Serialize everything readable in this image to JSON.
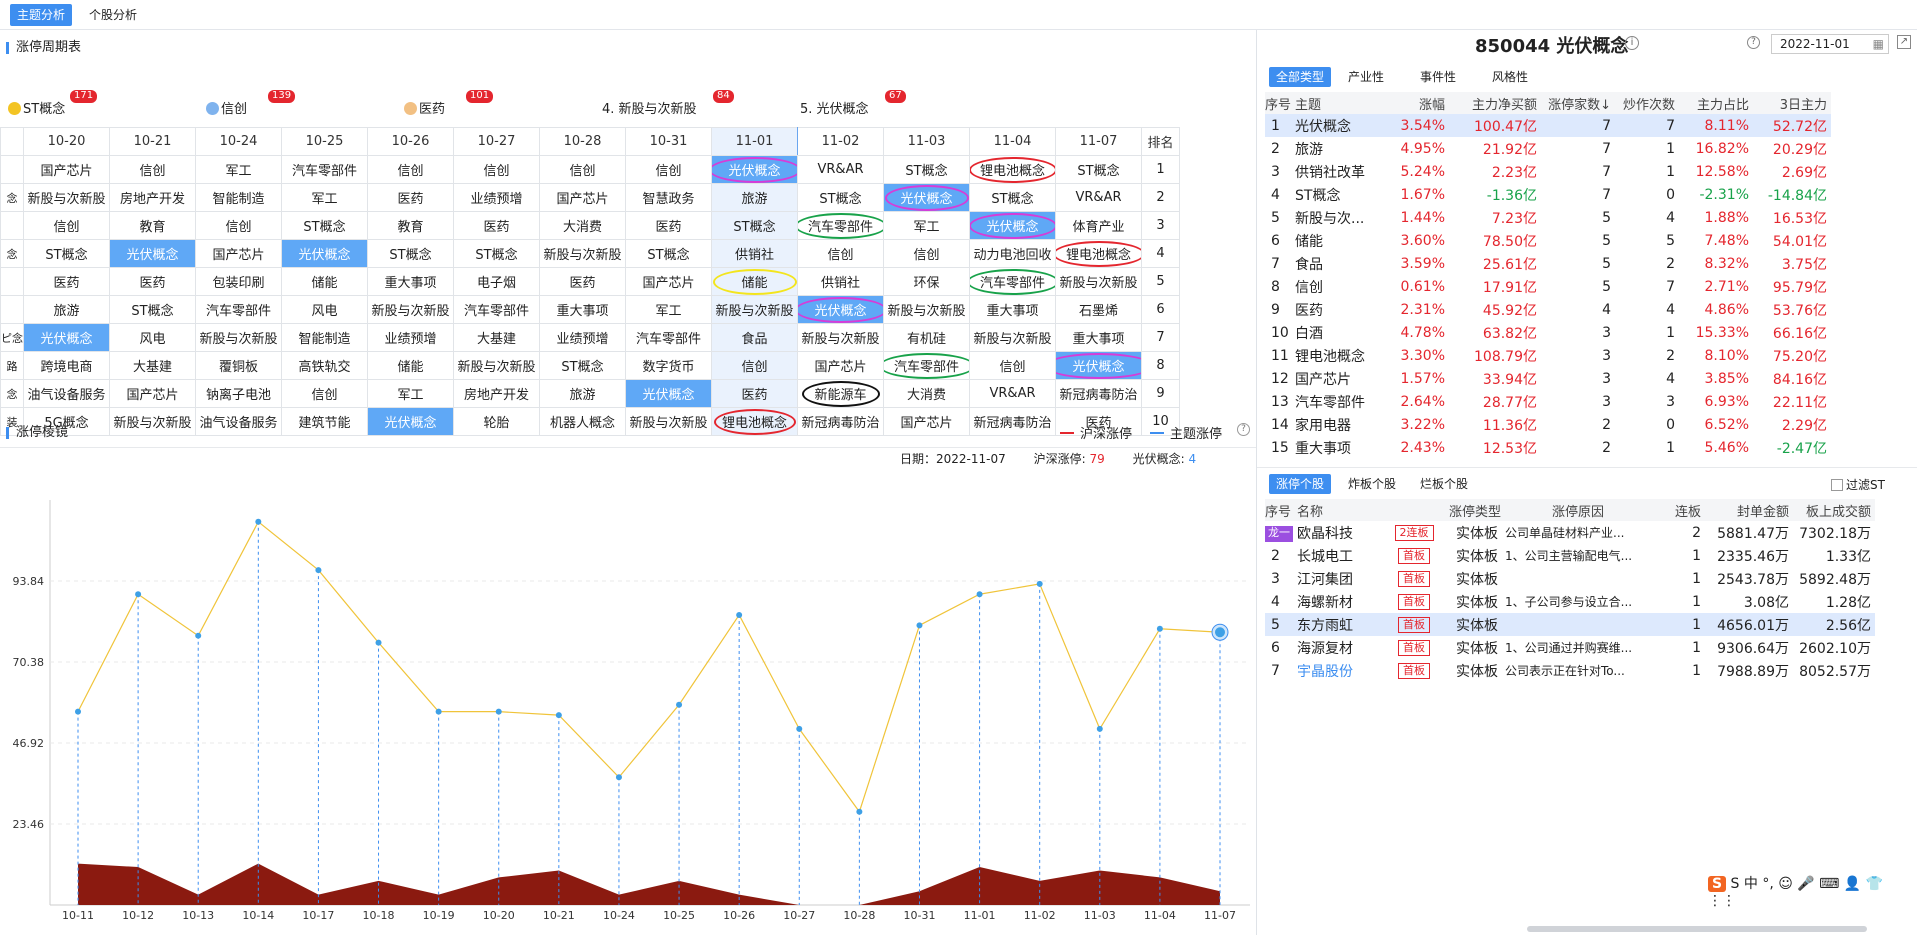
{
  "tabs": [
    "主题分析",
    "个股分析"
  ],
  "left": {
    "section1_title": "涨停周期表",
    "hot": [
      {
        "name": "ST概念",
        "count": "171",
        "dot": "#f3c424"
      },
      {
        "name": "信创",
        "count": "139",
        "dot": "#7fb3ee"
      },
      {
        "name": "医药",
        "count": "101",
        "dot": "#f2c083"
      },
      {
        "name": "4. 新股与次新股",
        "count": "84",
        "dot": ""
      },
      {
        "name": "5. 光伏概念",
        "count": "67",
        "dot": ""
      }
    ],
    "dates": [
      "10-20",
      "10-21",
      "10-24",
      "10-25",
      "10-26",
      "10-27",
      "10-28",
      "10-31",
      "11-01",
      "11-02",
      "11-03",
      "11-04",
      "11-07"
    ],
    "rank_label": "排名",
    "stub": [
      "",
      "念",
      "",
      "念",
      "",
      "",
      "ピ念",
      "路",
      "念",
      "装"
    ],
    "rows": [
      [
        "国产芯片",
        "信创",
        "军工",
        "汽车零部件",
        "信创",
        "信创",
        "信创",
        "信创",
        "光伏概念",
        "VR&AR",
        "ST概念",
        "锂电池概念",
        "ST概念"
      ],
      [
        "新股与次新股",
        "房地产开发",
        "智能制造",
        "军工",
        "医药",
        "业绩预增",
        "国产芯片",
        "智慧政务",
        "旅游",
        "ST概念",
        "光伏概念",
        "ST概念",
        "VR&AR"
      ],
      [
        "信创",
        "教育",
        "信创",
        "ST概念",
        "教育",
        "医药",
        "大消费",
        "医药",
        "ST概念",
        "汽车零部件",
        "军工",
        "光伏概念",
        "体育产业"
      ],
      [
        "ST概念",
        "光伏概念",
        "国产芯片",
        "光伏概念",
        "ST概念",
        "ST概念",
        "新股与次新股",
        "ST概念",
        "供销社",
        "信创",
        "信创",
        "动力电池回收",
        "锂电池概念"
      ],
      [
        "医药",
        "医药",
        "包装印刷",
        "储能",
        "重大事项",
        "电子烟",
        "医药",
        "国产芯片",
        "储能",
        "供销社",
        "环保",
        "汽车零部件",
        "新股与次新股"
      ],
      [
        "旅游",
        "ST概念",
        "汽车零部件",
        "风电",
        "新股与次新股",
        "汽车零部件",
        "重大事项",
        "军工",
        "新股与次新股",
        "光伏概念",
        "新股与次新股",
        "重大事项",
        "石墨烯"
      ],
      [
        "光伏概念",
        "风电",
        "新股与次新股",
        "智能制造",
        "业绩预增",
        "大基建",
        "业绩预增",
        "汽车零部件",
        "食品",
        "新股与次新股",
        "有机硅",
        "新股与次新股",
        "重大事项"
      ],
      [
        "跨境电商",
        "大基建",
        "覆铜板",
        "高铁轨交",
        "储能",
        "新股与次新股",
        "ST概念",
        "数字货币",
        "信创",
        "国产芯片",
        "汽车零部件",
        "信创",
        "光伏概念"
      ],
      [
        "油气设备服务",
        "国产芯片",
        "钠离子电池",
        "信创",
        "军工",
        "房地产开发",
        "旅游",
        "光伏概念",
        "医药",
        "新能源车",
        "大消费",
        "VR&AR",
        "新冠病毒防治"
      ],
      [
        "5G概念",
        "新股与次新股",
        "油气设备服务",
        "建筑节能",
        "光伏概念",
        "轮胎",
        "机器人概念",
        "新股与次新股",
        "锂电池概念",
        "新冠病毒防治",
        "国产芯片",
        "新冠病毒防治",
        "医药"
      ]
    ],
    "section2_title": "涨停棱镜",
    "legend": [
      {
        "label": "沪深涨停",
        "color": "#e4262e"
      },
      {
        "label": "主题涨停",
        "color": "#3d8ef0"
      }
    ],
    "info": {
      "date_label": "日期：",
      "date": "2022-11-07",
      "hs_label": "沪深涨停:",
      "hs": "79",
      "theme_label": "光伏概念:",
      "theme": "4"
    }
  },
  "chart_data": {
    "type": "line",
    "x": [
      "10-11",
      "10-12",
      "10-13",
      "10-14",
      "10-17",
      "10-18",
      "10-19",
      "10-20",
      "10-21",
      "10-24",
      "10-25",
      "10-26",
      "10-27",
      "10-28",
      "10-31",
      "11-01",
      "11-02",
      "11-03",
      "11-04",
      "11-07"
    ],
    "series": [
      {
        "name": "沪深涨停",
        "values": [
          56,
          90,
          78,
          111,
          97,
          76,
          56,
          56,
          55,
          37,
          58,
          84,
          51,
          27,
          81,
          90,
          93,
          51,
          80,
          79
        ]
      },
      {
        "name": "主题涨停",
        "values": [
          12,
          11,
          3,
          12,
          3,
          7,
          3,
          8,
          10,
          3,
          7,
          3,
          0,
          0,
          4,
          11,
          7,
          10,
          8,
          4
        ]
      }
    ],
    "yticks": [
      23.46,
      46.92,
      70.38,
      93.84
    ],
    "ylim": [
      0,
      117.3
    ]
  },
  "right": {
    "code_title": "850044 光伏概念",
    "date": "2022-11-01",
    "cat_tabs": [
      "全部类型",
      "产业性",
      "事件性",
      "风格性"
    ],
    "theme_headers": [
      "序号",
      "主题",
      "涨幅",
      "主力净买额",
      "涨停家数↓",
      "炒作次数",
      "主力占比",
      "3日主力"
    ],
    "themes": [
      [
        "1",
        "光伏概念",
        "3.54%",
        "100.47亿",
        "7",
        "7",
        "8.11%",
        "52.72亿"
      ],
      [
        "2",
        "旅游",
        "4.95%",
        "21.92亿",
        "7",
        "1",
        "16.82%",
        "20.29亿"
      ],
      [
        "3",
        "供销社改革",
        "5.24%",
        "2.23亿",
        "7",
        "1",
        "12.58%",
        "2.69亿"
      ],
      [
        "4",
        "ST概念",
        "1.67%",
        "-1.36亿",
        "7",
        "0",
        "-2.31%",
        "-14.84亿"
      ],
      [
        "5",
        "新股与次...",
        "1.44%",
        "7.23亿",
        "5",
        "4",
        "1.88%",
        "16.53亿"
      ],
      [
        "6",
        "储能",
        "3.60%",
        "78.50亿",
        "5",
        "5",
        "7.48%",
        "54.01亿"
      ],
      [
        "7",
        "食品",
        "3.59%",
        "25.61亿",
        "5",
        "2",
        "8.32%",
        "3.75亿"
      ],
      [
        "8",
        "信创",
        "0.61%",
        "17.91亿",
        "5",
        "7",
        "2.71%",
        "95.79亿"
      ],
      [
        "9",
        "医药",
        "2.31%",
        "45.92亿",
        "4",
        "4",
        "4.86%",
        "53.76亿"
      ],
      [
        "10",
        "白酒",
        "4.78%",
        "63.82亿",
        "3",
        "1",
        "15.33%",
        "66.16亿"
      ],
      [
        "11",
        "锂电池概念",
        "3.30%",
        "108.79亿",
        "3",
        "2",
        "8.10%",
        "75.20亿"
      ],
      [
        "12",
        "国产芯片",
        "1.57%",
        "33.94亿",
        "3",
        "4",
        "3.85%",
        "84.16亿"
      ],
      [
        "13",
        "汽车零部件",
        "2.64%",
        "28.77亿",
        "3",
        "3",
        "6.93%",
        "22.11亿"
      ],
      [
        "14",
        "家用电器",
        "3.22%",
        "11.36亿",
        "2",
        "0",
        "6.52%",
        "2.29亿"
      ],
      [
        "15",
        "重大事项",
        "2.43%",
        "12.53亿",
        "2",
        "1",
        "5.46%",
        "-2.47亿"
      ]
    ],
    "stock_tabs": [
      "涨停个股",
      "炸板个股",
      "烂板个股"
    ],
    "filter_label": "过滤ST",
    "stock_headers": [
      "序号",
      "名称",
      "涨停类型",
      "涨停原因",
      "连板",
      "封单金额",
      "板上成交额"
    ],
    "stocks": [
      [
        "龙一",
        "欧晶科技",
        "2连板",
        "实体板",
        "公司单晶硅材料产业...",
        "2",
        "5881.47万",
        "7302.18万"
      ],
      [
        "2",
        "长城电工",
        "首板",
        "实体板",
        "1、公司主营输配电气...",
        "1",
        "2335.46万",
        "1.33亿"
      ],
      [
        "3",
        "江河集团",
        "首板",
        "实体板",
        "",
        "1",
        "2543.78万",
        "5892.48万"
      ],
      [
        "4",
        "海螺新材",
        "首板",
        "实体板",
        "1、子公司参与设立合...",
        "1",
        "3.08亿",
        "1.28亿"
      ],
      [
        "5",
        "东方雨虹",
        "首板",
        "实体板",
        "",
        "1",
        "4656.01万",
        "2.56亿"
      ],
      [
        "6",
        "海源复材",
        "首板",
        "实体板",
        "1、公司通过并购赛维...",
        "1",
        "9306.64万",
        "2602.10万"
      ],
      [
        "7",
        "宇晶股份",
        "首板",
        "实体板",
        "公司表示正在针对To...",
        "1",
        "7988.89万",
        "8052.57万"
      ]
    ],
    "ime": "S 中 °, ☺ 🎤 ⌨ 👤 👕 ⋮⋮"
  }
}
